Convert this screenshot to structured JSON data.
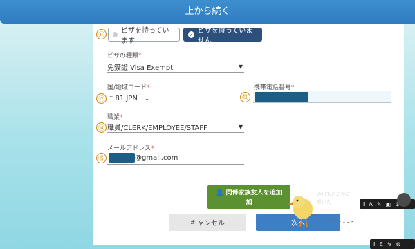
{
  "header": {
    "title": "上から続く"
  },
  "steps": {
    "n11": "⑪",
    "n12": "⑫",
    "n13": "⑬",
    "n14": "⑭",
    "n15": "⑮"
  },
  "visa_choice": {
    "have_label": "ビザを持っています",
    "not_have_label": "ビザを持っていません",
    "selected": "not_have"
  },
  "visa_type": {
    "label": "ビザの種類",
    "required": "*",
    "value": "免簽證 Visa Exempt"
  },
  "country_code": {
    "label": "国/地域コード",
    "required": "*",
    "value": "⁺ 81 JPN"
  },
  "phone": {
    "label": "携帯電話番号",
    "required": "*"
  },
  "occupation": {
    "label": "職業",
    "required": "*",
    "value": "職員/CLERK/EMPLOYEE/STAFF"
  },
  "email": {
    "label": "メールアドレス",
    "required": "*",
    "domain": "@gmail.com"
  },
  "buttons": {
    "add_companion": "同伴家族友人を追加",
    "add_companion_line2": "加",
    "cancel": "キャンセル",
    "next": "次へ"
  },
  "overlay": {
    "bubble_line1": "近日もどこかに",
    "bubble_line2": "咲いた"
  },
  "colors": {
    "header": "#2f7cc0",
    "selected_radio": "#2c4f7c",
    "add_button": "#5b9130",
    "next_button": "#3e7ec4",
    "required": "#dd3333",
    "step_number": "#d08a10"
  }
}
